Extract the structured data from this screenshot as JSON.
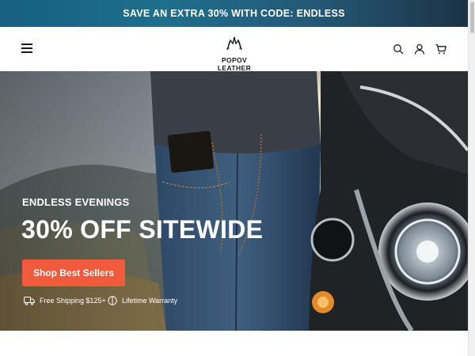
{
  "announcement": {
    "text": "SAVE AN EXTRA 30% WITH CODE: ENDLESS"
  },
  "header": {
    "logo_text": "POPOV LEATHER",
    "icons": [
      "menu-icon",
      "search-icon",
      "account-icon",
      "cart-icon"
    ]
  },
  "hero": {
    "eyebrow": "ENDLESS EVENINGS",
    "headline": "30% OFF SITEWIDE",
    "cta_label": "Shop Best Sellers",
    "perks": [
      {
        "icon": "truck-icon",
        "label": "Free Shipping $125+"
      },
      {
        "icon": "shield-icon",
        "label": "Lifetime Warranty"
      }
    ]
  },
  "colors": {
    "announcement_bg": "#1d6f8c",
    "cta_bg": "#f25a3d",
    "text_dark": "#1a1a1a"
  }
}
